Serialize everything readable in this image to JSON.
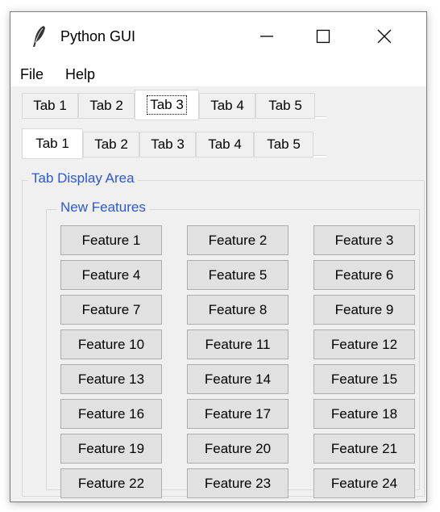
{
  "window": {
    "title": "Python GUI"
  },
  "menu": {
    "items": [
      "File",
      "Help"
    ]
  },
  "tabs_top": {
    "labels": [
      "Tab 1",
      "Tab 2",
      "Tab 3",
      "Tab 4",
      "Tab 5"
    ],
    "selected": "Tab 3"
  },
  "tabs_bottom": {
    "labels": [
      "Tab 1",
      "Tab 2",
      "Tab 3",
      "Tab 4",
      "Tab 5"
    ],
    "selected": "Tab 1"
  },
  "tab_area": {
    "label": "Tab Display Area",
    "group_label": "New Features",
    "features": [
      "Feature 1",
      "Feature 2",
      "Feature 3",
      "Feature 4",
      "Feature 5",
      "Feature 6",
      "Feature 7",
      "Feature 8",
      "Feature 9",
      "Feature 10",
      "Feature 11",
      "Feature 12",
      "Feature 13",
      "Feature 14",
      "Feature 15",
      "Feature 16",
      "Feature 17",
      "Feature 18",
      "Feature 19",
      "Feature 20",
      "Feature 21",
      "Feature 22",
      "Feature 23",
      "Feature 24"
    ]
  },
  "icons": {
    "app": "feather-icon",
    "minimize": "minimize-icon",
    "maximize": "maximize-icon",
    "close": "close-icon"
  },
  "colors": {
    "group_label": "#2b57d6",
    "window_bg": "#f0f0f0",
    "button_bg": "#e1e1e1"
  }
}
